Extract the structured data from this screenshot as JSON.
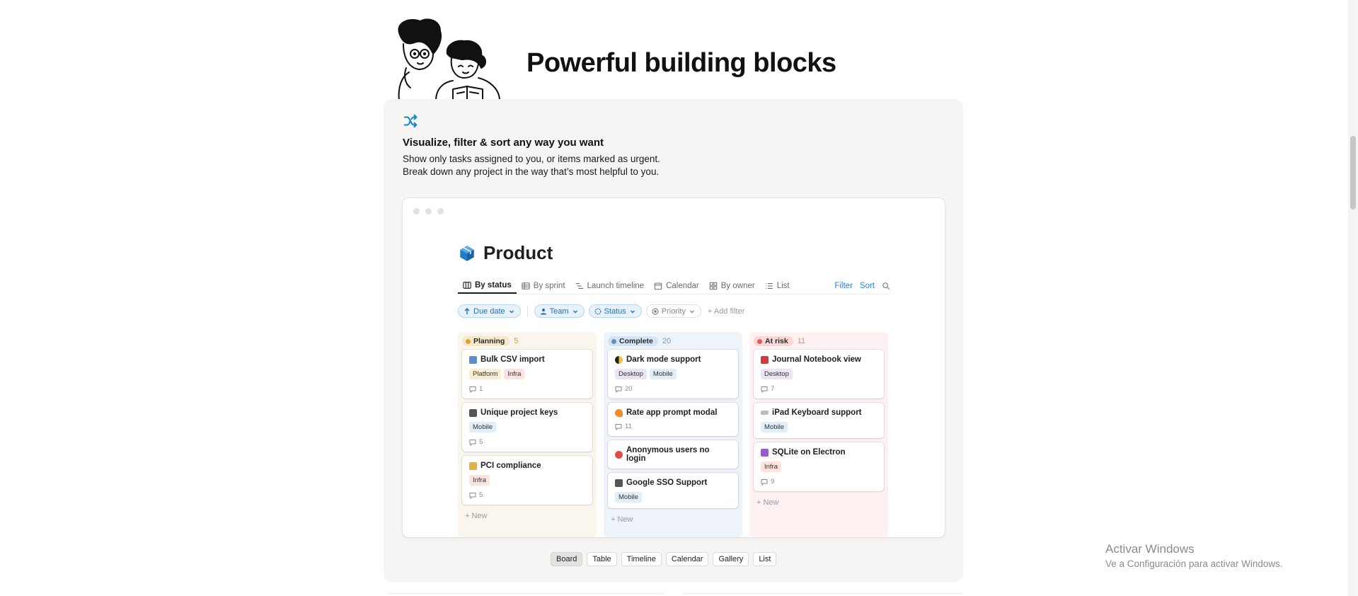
{
  "hero": {
    "title": "Powerful building blocks"
  },
  "feature": {
    "icon": "shuffle-icon",
    "title": "Visualize, filter & sort any way you want",
    "desc_line1": "Show only tasks assigned to you, or items marked as urgent.",
    "desc_line2": "Break down any project in the way that’s most helpful to you."
  },
  "product": {
    "title": "Product",
    "tabs": [
      {
        "label": "By status",
        "icon": "board-icon"
      },
      {
        "label": "By sprint",
        "icon": "table-icon"
      },
      {
        "label": "Launch timeline",
        "icon": "timeline-icon"
      },
      {
        "label": "Calendar",
        "icon": "calendar-icon"
      },
      {
        "label": "By owner",
        "icon": "gallery-icon"
      },
      {
        "label": "List",
        "icon": "list-icon"
      }
    ],
    "actions": {
      "filter": "Filter",
      "sort": "Sort"
    },
    "filters": {
      "due_date": "Due date",
      "team": "Team",
      "status": "Status",
      "priority": "Priority",
      "add_filter": "+ Add filter"
    },
    "columns": [
      {
        "name": "Planning",
        "count": "5",
        "cards": [
          {
            "title": "Bulk CSV import",
            "tags": [
              "Platform",
              "Infra"
            ],
            "comments": "1"
          },
          {
            "title": "Unique project keys",
            "tags": [
              "Mobile"
            ],
            "comments": "5"
          },
          {
            "title": "PCI compliance",
            "tags": [
              "Infra"
            ],
            "comments": "5"
          }
        ],
        "new": "+ New"
      },
      {
        "name": "Complete",
        "count": "20",
        "cards": [
          {
            "title": "Dark mode support",
            "tags": [
              "Desktop",
              "Mobile"
            ],
            "comments": "20"
          },
          {
            "title": "Rate app prompt modal",
            "comments": "11"
          },
          {
            "title": "Anonymous users no login"
          },
          {
            "title": "Google SSO Support",
            "tags": [
              "Mobile"
            ]
          }
        ],
        "new": "+ New"
      },
      {
        "name": "At risk",
        "count": "11",
        "cards": [
          {
            "title": "Journal Notebook view",
            "tags": [
              "Desktop"
            ],
            "comments": "7"
          },
          {
            "title": "iPad Keyboard support",
            "tags": [
              "Mobile"
            ]
          },
          {
            "title": "SQLite on Electron",
            "tags": [
              "Infra"
            ],
            "comments": "9"
          }
        ],
        "new": "+ New"
      }
    ]
  },
  "view_switcher": [
    "Board",
    "Table",
    "Timeline",
    "Calendar",
    "Gallery",
    "List"
  ],
  "watermark": {
    "line1": "Activar Windows",
    "line2": "Ve a Configuración para activar Windows."
  },
  "colors": {
    "accent": "#2383e2",
    "card_bg": "#f6f5f4"
  }
}
